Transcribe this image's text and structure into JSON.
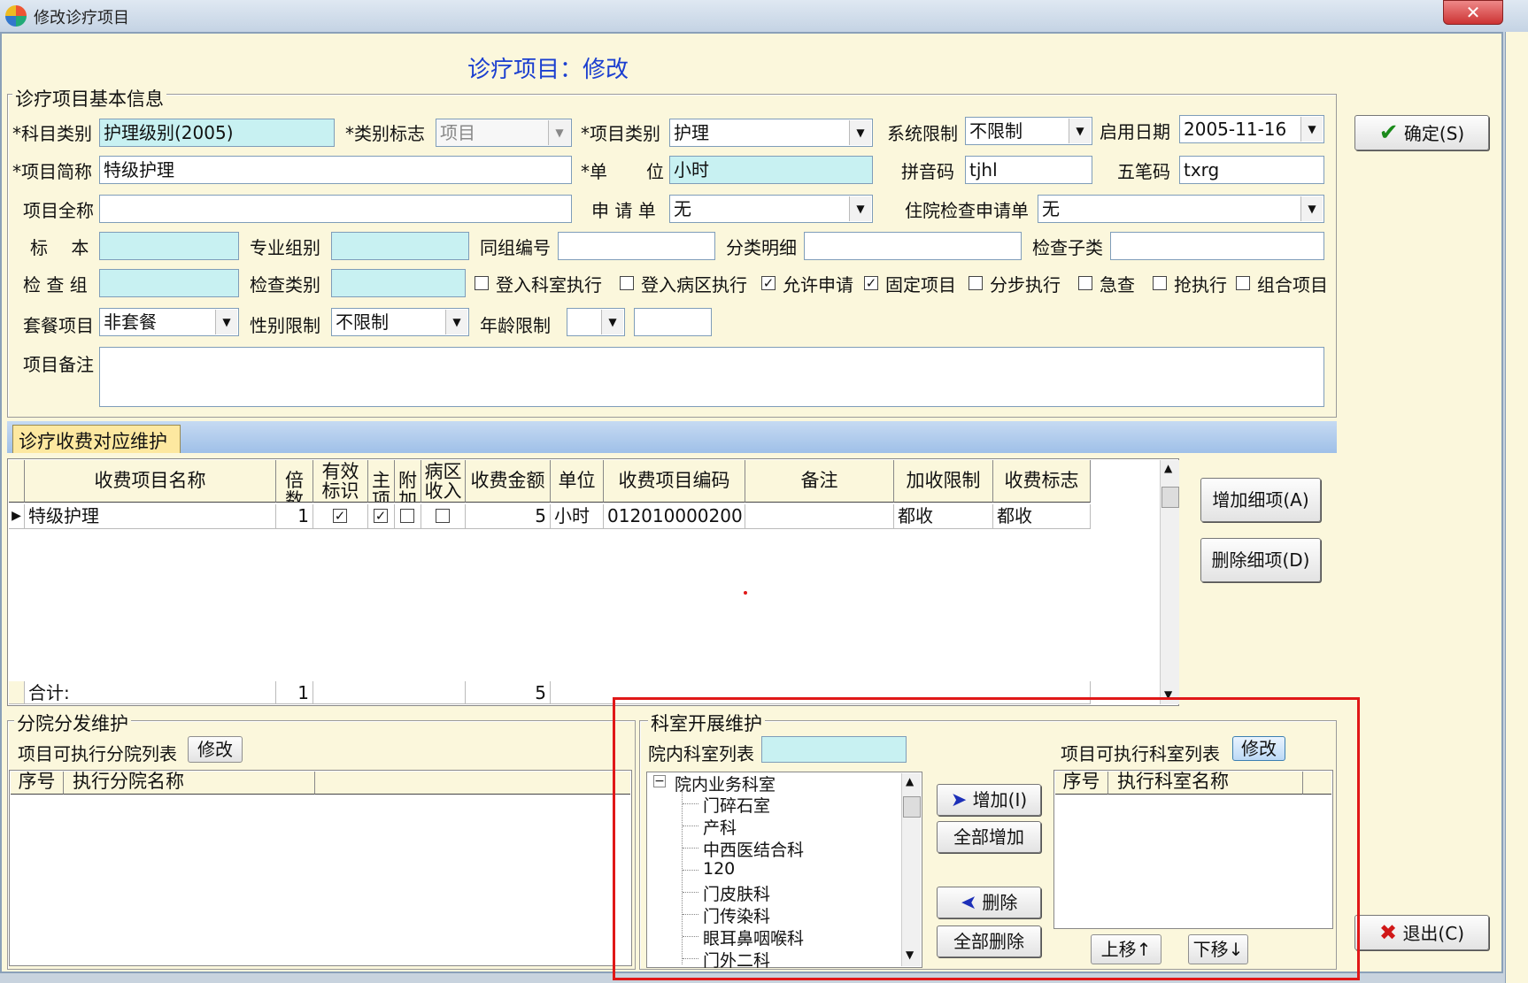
{
  "window": {
    "title": "修改诊疗项目",
    "close_label": "✕",
    "header": "诊疗项目：修改"
  },
  "basic": {
    "group_title": "诊疗项目基本信息",
    "subject_label": "*科目类别",
    "subject_value": "护理级别(2005)",
    "category_flag_label": "*类别标志",
    "category_flag_value": "项目",
    "item_type_label": "*项目类别",
    "item_type_value": "护理",
    "sys_limit_label": "系统限制",
    "sys_limit_value": "不限制",
    "start_date_label": "启用日期",
    "start_date_value": "2005-11-16",
    "short_name_label": "*项目简称",
    "short_name_value": "特级护理",
    "unit_label_1": "*单",
    "unit_label_2": "位",
    "unit_value": "小时",
    "pinyin_label": "拼音码",
    "pinyin_value": "tjhl",
    "wubi_label": "五笔码",
    "wubi_value": "txrg",
    "full_name_label": "项目全称",
    "full_name_value": "",
    "apply_form_label": "申 请 单",
    "apply_form_value": "无",
    "inpatient_apply_label": "住院检查申请单",
    "inpatient_apply_value": "无",
    "specimen_label": "标　 本",
    "specialty_label": "专业组别",
    "group_no_label": "同组编号",
    "class_detail_label": "分类明细",
    "check_sub_label": "检查子类",
    "check_group_label": "检 查 组",
    "check_type_label": "检查类别",
    "checks": [
      {
        "label": "登入科室执行",
        "checked": false
      },
      {
        "label": "登入病区执行",
        "checked": false
      },
      {
        "label": "允许申请",
        "checked": true
      },
      {
        "label": "固定项目",
        "checked": true
      },
      {
        "label": "分步执行",
        "checked": false
      },
      {
        "label": "急查",
        "checked": false
      },
      {
        "label": "抢执行",
        "checked": false
      },
      {
        "label": "组合项目",
        "checked": false
      }
    ],
    "package_label": "套餐项目",
    "package_value": "非套餐",
    "gender_label": "性别限制",
    "gender_value": "不限制",
    "age_label": "年龄限制",
    "age_value": "",
    "remark_label": "项目备注"
  },
  "buttons": {
    "ok": "确定(S)",
    "exit": "退出(C)",
    "add_detail": "增加细项(A)",
    "del_detail": "删除细项(D)"
  },
  "fee": {
    "tab_label": "诊疗收费对应维护",
    "columns": [
      "收费项目名称",
      "倍数",
      "有效标识",
      "主项",
      "附加",
      "病区收入",
      "收费金额",
      "单位",
      "收费项目编码",
      "备注",
      "加收限制",
      "收费标志"
    ],
    "row": {
      "name": "特级护理",
      "multiple": "1",
      "amount": "5",
      "unit": "小时",
      "code": "012010000200",
      "remark": "",
      "limit": "都收",
      "flag": "都收"
    },
    "total_label": "合计:",
    "total_multiple": "1",
    "total_amount": "5"
  },
  "branch": {
    "group_title": "分院分发维护",
    "list_label": "项目可执行分院列表",
    "modify_btn": "修改",
    "col_no": "序号",
    "col_name": "执行分院名称"
  },
  "dept": {
    "group_title": "科室开展维护",
    "inner_label": "院内科室列表",
    "exec_label": "项目可执行科室列表",
    "modify_btn": "修改",
    "tree_root": "院内业务科室",
    "tree_items": [
      "门碎石室",
      "产科",
      "中西医结合科",
      "120",
      "门皮肤科",
      "门传染科",
      "眼耳鼻咽喉科",
      "门外二科"
    ],
    "add_btn": "增加(I)",
    "add_all_btn": "全部增加",
    "del_btn": "删除",
    "del_all_btn": "全部删除",
    "col_no": "序号",
    "col_name": "执行科室名称",
    "up_btn": "上移↑",
    "down_btn": "下移↓"
  },
  "colors": {
    "accent_header": "#1b3fd0",
    "highlight_box": "#e01818",
    "required_bg": "#c8f1f2"
  }
}
